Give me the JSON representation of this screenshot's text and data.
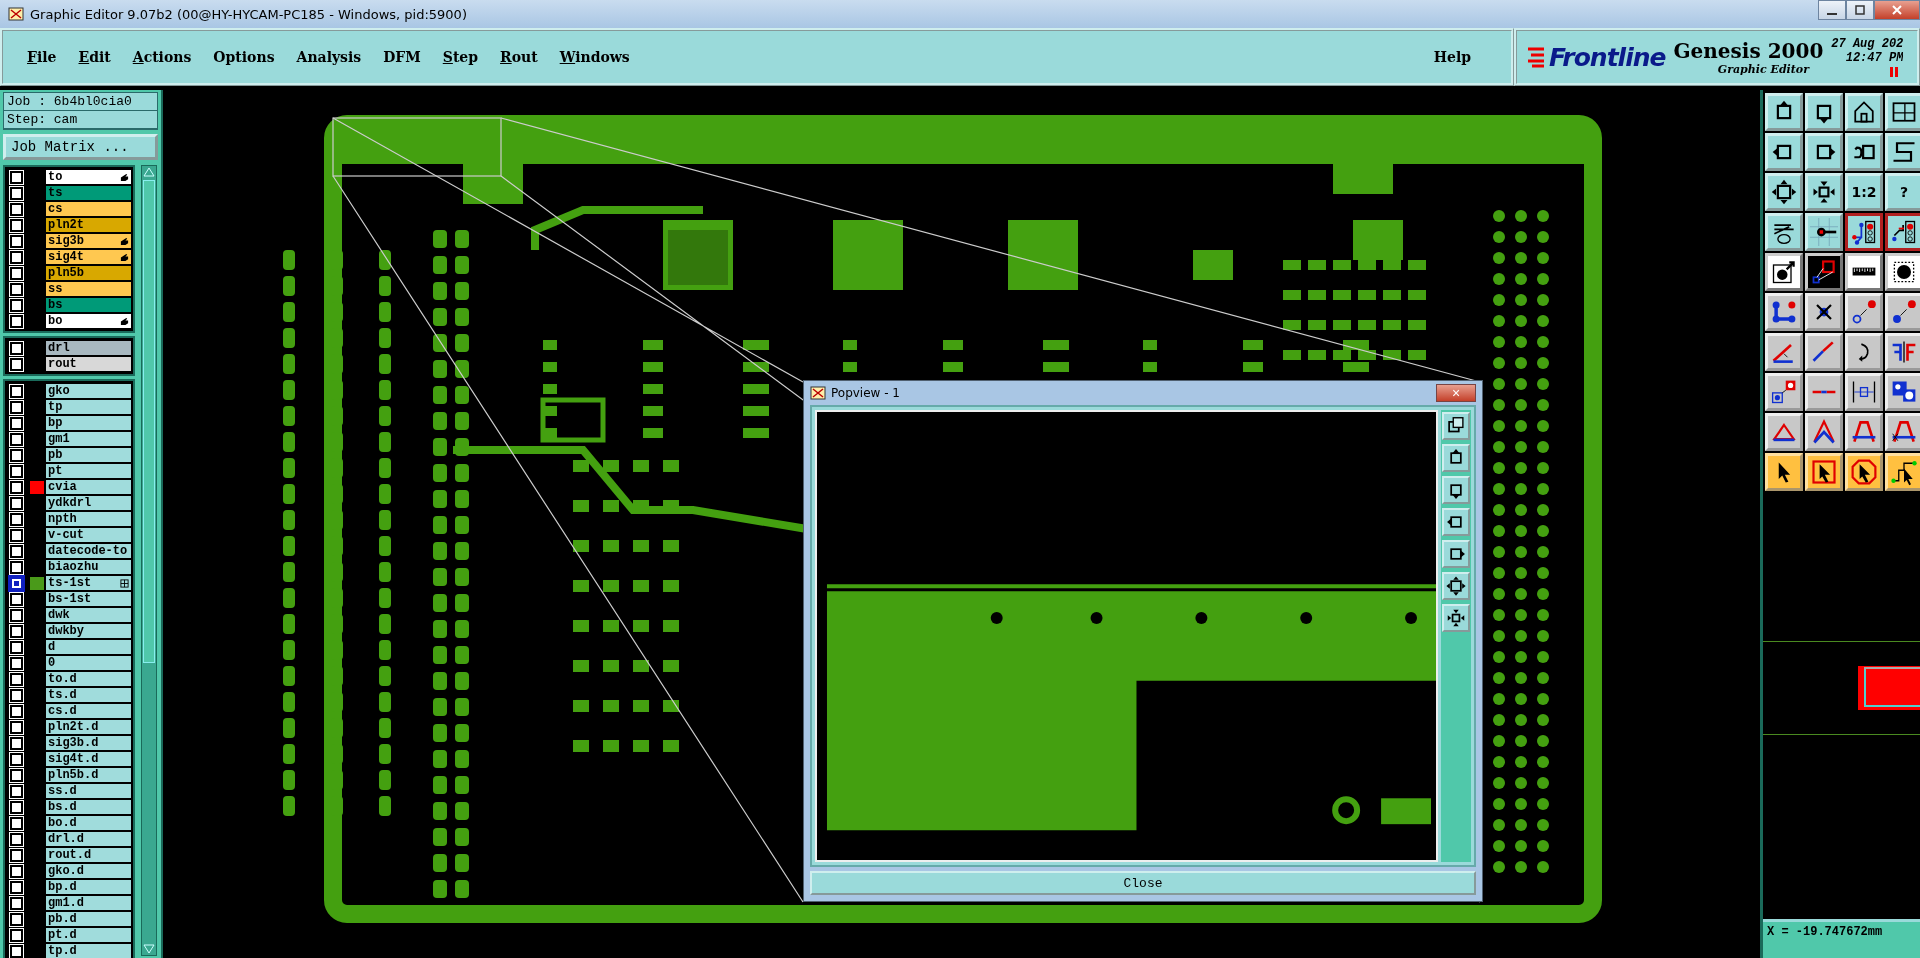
{
  "window": {
    "title": "Graphic Editor 9.07b2 (00@HY-HYCAM-PC185 - Windows, pid:5900)"
  },
  "menu": [
    {
      "label": "File",
      "mnemonic": true
    },
    {
      "label": "Edit",
      "mnemonic": true
    },
    {
      "label": "Actions",
      "mnemonic": true
    },
    {
      "label": "Options",
      "mnemonic": false
    },
    {
      "label": "Analysis",
      "mnemonic": false
    },
    {
      "label": "DFM",
      "mnemonic": false
    },
    {
      "label": "Step",
      "mnemonic": true
    },
    {
      "label": "Rout",
      "mnemonic": true
    },
    {
      "label": "Windows",
      "mnemonic": true
    }
  ],
  "help": "Help",
  "brand": {
    "logo": "Frontline",
    "product": "Genesis 2000",
    "module": "Graphic Editor",
    "date": "27 Aug 202",
    "time": "12:47 PM"
  },
  "job": {
    "job": "Job : 6b4bl0cia0",
    "step": "Step: cam",
    "matrix_button": "Job Matrix ..."
  },
  "layer_groups": [
    {
      "layers": [
        {
          "name": "to",
          "color": "#ffffff",
          "selected": false,
          "hand": true,
          "grid": false
        },
        {
          "name": "ts",
          "color": "#009a78",
          "selected": false,
          "hand": false,
          "grid": false
        },
        {
          "name": "cs",
          "color": "#ffc850",
          "selected": false,
          "hand": false,
          "grid": false
        },
        {
          "name": "pln2t",
          "color": "#d8a800",
          "selected": false,
          "hand": false,
          "grid": false
        },
        {
          "name": "sig3b",
          "color": "#ffc850",
          "selected": false,
          "hand": true,
          "grid": false
        },
        {
          "name": "sig4t",
          "color": "#ffc850",
          "selected": false,
          "hand": true,
          "grid": false
        },
        {
          "name": "pln5b",
          "color": "#d8a800",
          "selected": false,
          "hand": false,
          "grid": false
        },
        {
          "name": "ss",
          "color": "#ffc850",
          "selected": false,
          "hand": false,
          "grid": false
        },
        {
          "name": "bs",
          "color": "#009a78",
          "selected": false,
          "hand": false,
          "grid": false
        },
        {
          "name": "bo",
          "color": "#ffffff",
          "selected": false,
          "hand": true,
          "grid": false
        }
      ]
    },
    {
      "layers": [
        {
          "name": "drl",
          "color": "#a8b8c0",
          "selected": false,
          "hand": false,
          "grid": false
        },
        {
          "name": "rout",
          "color": "#d8d8d8",
          "selected": false,
          "hand": false,
          "grid": false
        }
      ]
    },
    {
      "layers": [
        {
          "name": "gko",
          "color": "#a0dcdc",
          "selected": false,
          "hand": false,
          "grid": false
        },
        {
          "name": "tp",
          "color": "#a0dcdc",
          "selected": false,
          "hand": false,
          "grid": false
        },
        {
          "name": "bp",
          "color": "#a0dcdc",
          "selected": false,
          "hand": false,
          "grid": false
        },
        {
          "name": "gm1",
          "color": "#a0dcdc",
          "selected": false,
          "hand": false,
          "grid": false
        },
        {
          "name": "pb",
          "color": "#a0dcdc",
          "selected": false,
          "hand": false,
          "grid": false
        },
        {
          "name": "pt",
          "color": "#a0dcdc",
          "selected": false,
          "hand": false,
          "grid": false
        },
        {
          "name": "cvia",
          "color": "#a0dcdc",
          "selected": false,
          "hand": false,
          "grid": false,
          "swatch": {
            "color": "#ff0000"
          }
        },
        {
          "name": "ydkdrl",
          "color": "#a0dcdc",
          "selected": false,
          "hand": false,
          "grid": false
        },
        {
          "name": "npth",
          "color": "#a0dcdc",
          "selected": false,
          "hand": false,
          "grid": false
        },
        {
          "name": "v-cut",
          "color": "#a0dcdc",
          "selected": false,
          "hand": false,
          "grid": false
        },
        {
          "name": "datecode-to",
          "color": "#a0dcdc",
          "selected": false,
          "hand": false,
          "grid": false
        },
        {
          "name": "biaozhu",
          "color": "#a0dcdc",
          "selected": false,
          "hand": false,
          "grid": false
        },
        {
          "name": "ts-1st",
          "color": "#a0dcdc",
          "selected": true,
          "hand": false,
          "grid": true,
          "swatch": {
            "color": "#4a9a1a"
          }
        },
        {
          "name": "bs-1st",
          "color": "#a0dcdc",
          "selected": false,
          "hand": false,
          "grid": false
        },
        {
          "name": "dwk",
          "color": "#a0dcdc",
          "selected": false,
          "hand": false,
          "grid": false
        },
        {
          "name": "dwkby",
          "color": "#a0dcdc",
          "selected": false,
          "hand": false,
          "grid": false
        },
        {
          "name": "d",
          "color": "#a0dcdc",
          "selected": false,
          "hand": false,
          "grid": false
        },
        {
          "name": "0",
          "color": "#a0dcdc",
          "selected": false,
          "hand": false,
          "grid": false
        },
        {
          "name": "to.d",
          "color": "#a0dcdc",
          "selected": false,
          "hand": false,
          "grid": false
        },
        {
          "name": "ts.d",
          "color": "#a0dcdc",
          "selected": false,
          "hand": false,
          "grid": false
        },
        {
          "name": "cs.d",
          "color": "#a0dcdc",
          "selected": false,
          "hand": false,
          "grid": false
        },
        {
          "name": "pln2t.d",
          "color": "#a0dcdc",
          "selected": false,
          "hand": false,
          "grid": false
        },
        {
          "name": "sig3b.d",
          "color": "#a0dcdc",
          "selected": false,
          "hand": false,
          "grid": false
        },
        {
          "name": "sig4t.d",
          "color": "#a0dcdc",
          "selected": false,
          "hand": false,
          "grid": false
        },
        {
          "name": "pln5b.d",
          "color": "#a0dcdc",
          "selected": false,
          "hand": false,
          "grid": false
        },
        {
          "name": "ss.d",
          "color": "#a0dcdc",
          "selected": false,
          "hand": false,
          "grid": false
        },
        {
          "name": "bs.d",
          "color": "#a0dcdc",
          "selected": false,
          "hand": false,
          "grid": false
        },
        {
          "name": "bo.d",
          "color": "#a0dcdc",
          "selected": false,
          "hand": false,
          "grid": false
        },
        {
          "name": "drl.d",
          "color": "#a0dcdc",
          "selected": false,
          "hand": false,
          "grid": false
        },
        {
          "name": "rout.d",
          "color": "#a0dcdc",
          "selected": false,
          "hand": false,
          "grid": false
        },
        {
          "name": "gko.d",
          "color": "#a0dcdc",
          "selected": false,
          "hand": false,
          "grid": false
        },
        {
          "name": "bp.d",
          "color": "#a0dcdc",
          "selected": false,
          "hand": false,
          "grid": false
        },
        {
          "name": "gm1.d",
          "color": "#a0dcdc",
          "selected": false,
          "hand": false,
          "grid": false
        },
        {
          "name": "pb.d",
          "color": "#a0dcdc",
          "selected": false,
          "hand": false,
          "grid": false
        },
        {
          "name": "pt.d",
          "color": "#a0dcdc",
          "selected": false,
          "hand": false,
          "grid": false
        },
        {
          "name": "tp.d",
          "color": "#a0dcdc",
          "selected": false,
          "hand": false,
          "grid": false
        }
      ]
    }
  ],
  "toolbar": {
    "ratio_button": "1:2",
    "help_button": "?"
  },
  "popview": {
    "title": "Popview - 1",
    "close_glyph": "×",
    "close_button": "Close"
  },
  "coordinates": {
    "x": "X = -19.747672mm"
  }
}
